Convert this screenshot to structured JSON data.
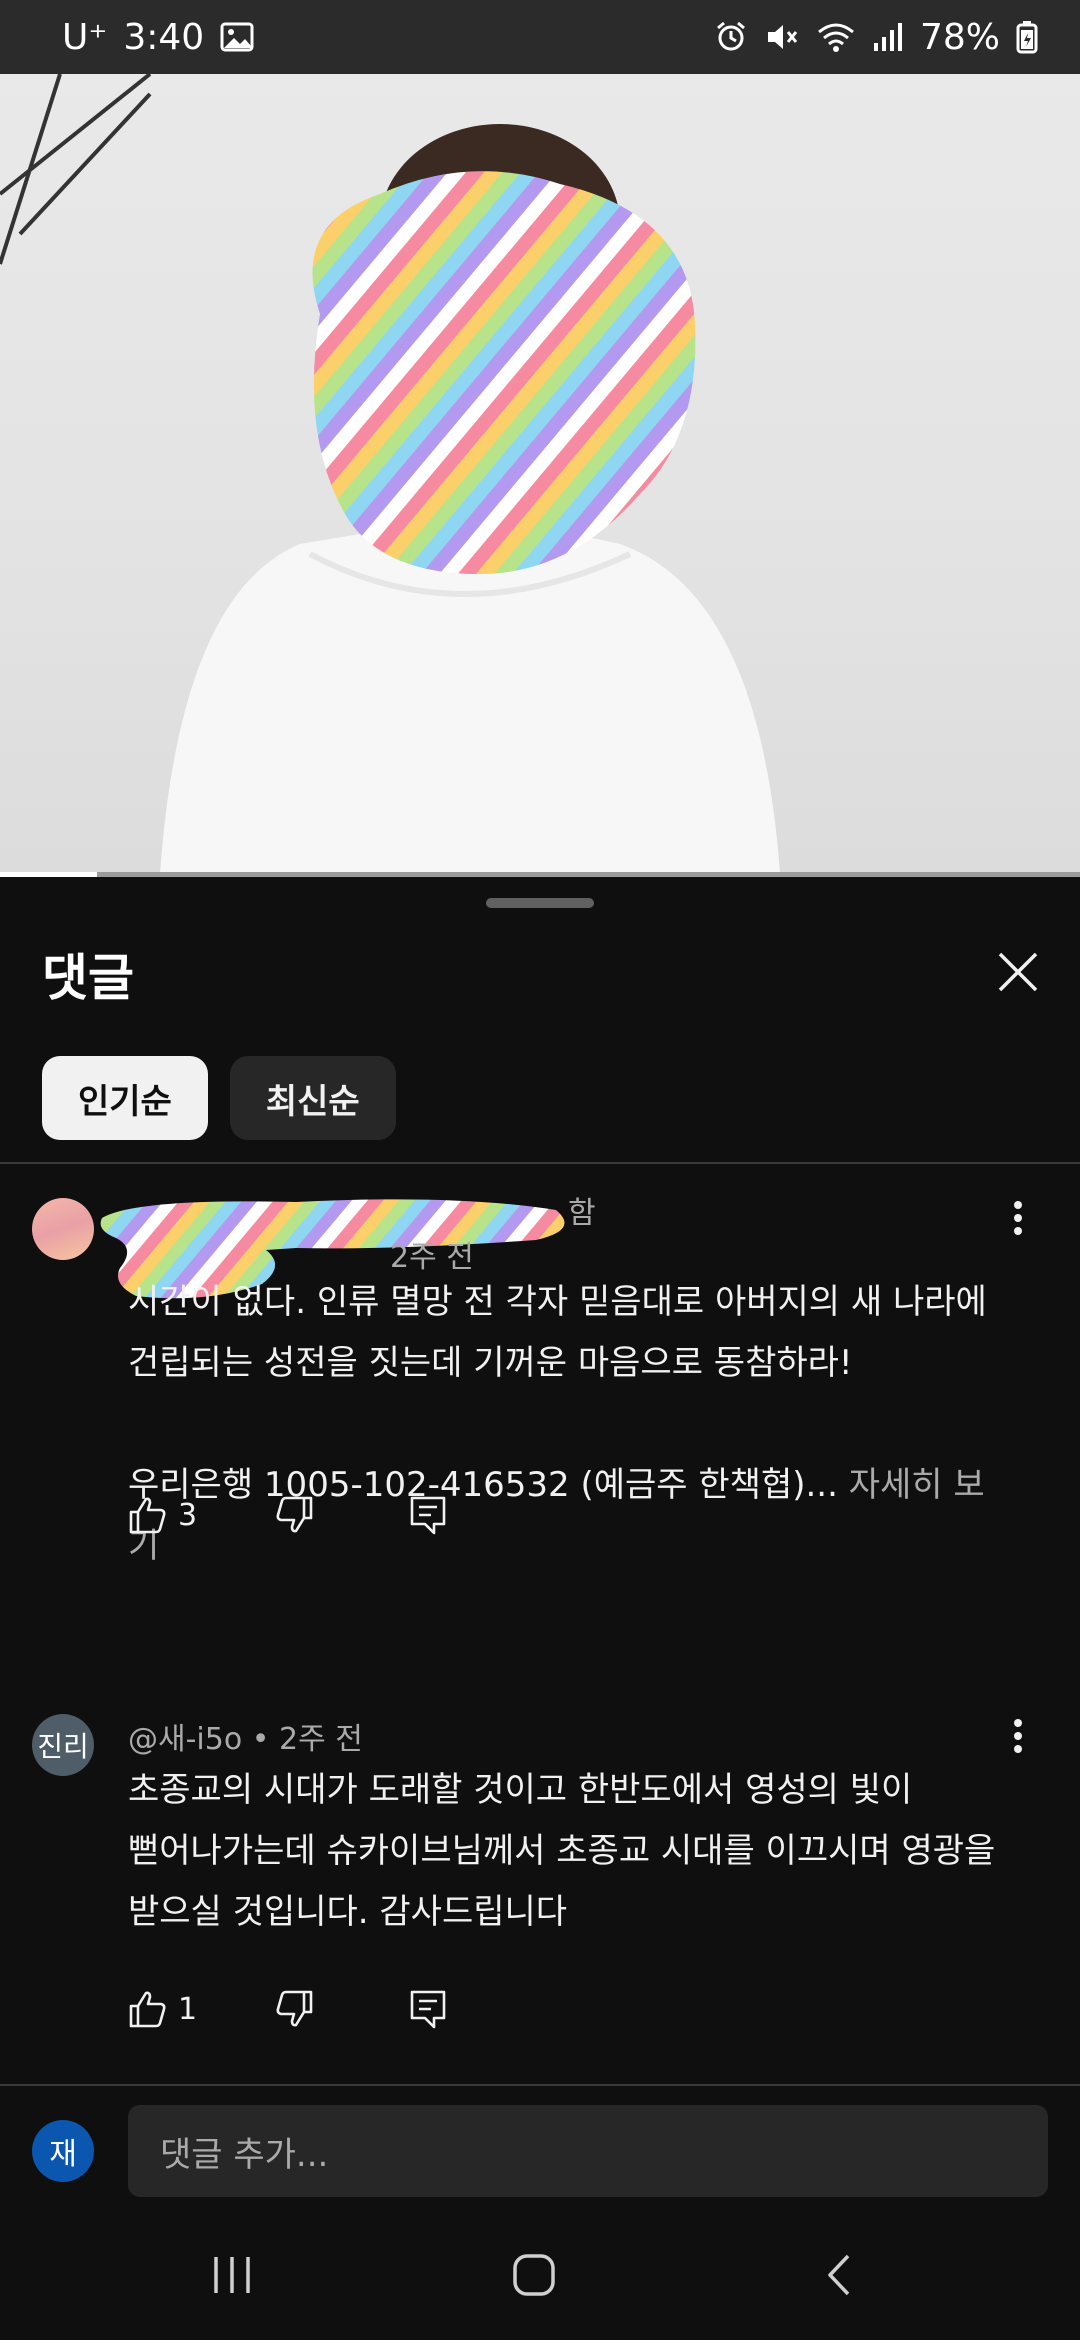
{
  "status_bar": {
    "carrier": "U⁺",
    "time": "3:40",
    "battery": "78%",
    "icons": [
      "gallery-icon",
      "alarm-icon",
      "mute-icon",
      "wifi-icon",
      "signal-icon",
      "battery-icon"
    ]
  },
  "video": {
    "progress": 0.09
  },
  "sheet": {
    "title": "댓글",
    "chips": [
      {
        "label": "인기순",
        "active": true
      },
      {
        "label": "최신순",
        "active": false
      }
    ]
  },
  "comments": [
    {
      "author_visible": "함",
      "time": "2주 전",
      "lines": [
        "시간이 없다. 인류 멸망 전 각자 믿음대로 아버지의 새 나라에",
        "건립되는 성전을 짓는데 기꺼운 마음으로 동참하라!",
        "",
        "우리은행 1005-102-416532 (예금주 한책협)..."
      ],
      "more": "자세히 보기",
      "likes": "3"
    },
    {
      "avatar_text": "진리",
      "author": "@새-i5o",
      "time": "2주 전",
      "lines": [
        "초종교의 시대가 도래할 것이고  한반도에서 영성의 빛이",
        "뻗어나가는데 슈카이브님께서 초종교 시대를 이끄시며 영광을",
        "받으실 것입니다. 감사드립니다"
      ],
      "likes": "1"
    }
  ],
  "composer": {
    "avatar_text": "재",
    "placeholder": "댓글 추가..."
  },
  "colors": {
    "accent_blue": "#0b57b0",
    "background": "#0f0f0f",
    "secondary_text": "#aaaaaa"
  }
}
